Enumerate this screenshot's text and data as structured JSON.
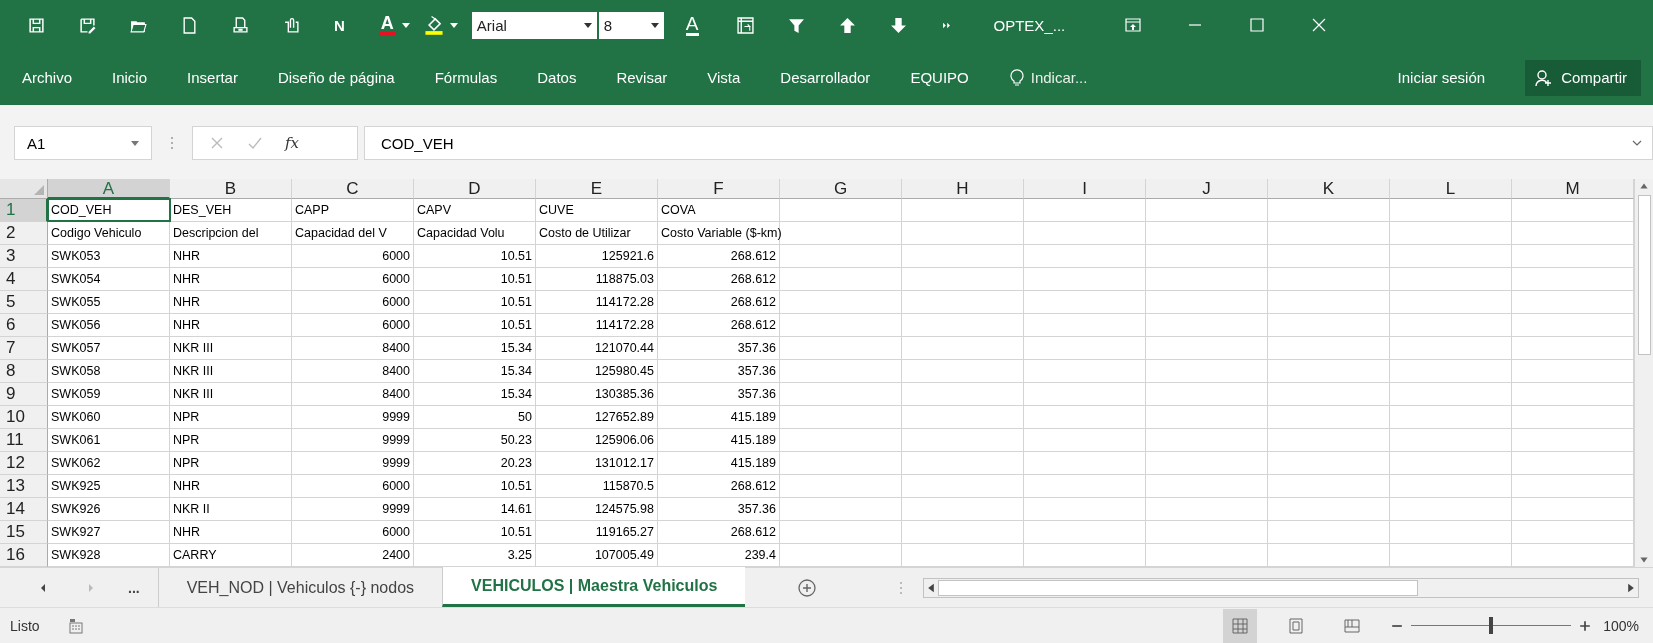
{
  "title_bar": {
    "toolbar": [
      {
        "kind": "save"
      },
      {
        "kind": "save-edit"
      },
      {
        "kind": "folder"
      },
      {
        "kind": "page"
      },
      {
        "kind": "print-preview"
      },
      {
        "kind": "attach"
      },
      {
        "kind": "letter",
        "label": "N"
      },
      {
        "kind": "font-color",
        "label": "A",
        "color": "#e81123"
      },
      {
        "kind": "highlight",
        "color": "#ffff00"
      },
      {
        "kind": "font",
        "value": "Arial"
      },
      {
        "kind": "size",
        "value": "8"
      },
      {
        "kind": "underline-letter",
        "label": "A"
      },
      {
        "kind": "pivot"
      },
      {
        "kind": "filter"
      },
      {
        "kind": "arrow-up"
      },
      {
        "kind": "arrow-down"
      },
      {
        "kind": "more"
      }
    ],
    "title": "OPTEX_..."
  },
  "ribbon_tabs": [
    "Archivo",
    "Inicio",
    "Insertar",
    "Diseño de página",
    "Fórmulas",
    "Datos",
    "Revisar",
    "Vista",
    "Desarrollador",
    "EQUIPO"
  ],
  "tell_me": "Indicar...",
  "sign_in": "Iniciar sesión",
  "share": "Compartir",
  "formula_bar": {
    "name_box": "A1",
    "fx": "fx",
    "formula": "COD_VEH"
  },
  "columns": [
    {
      "label": "A",
      "kind": "text",
      "selected": true
    },
    {
      "label": "B",
      "kind": "text",
      "selected": false
    },
    {
      "label": "C",
      "kind": "number",
      "selected": false
    },
    {
      "label": "D",
      "kind": "number",
      "selected": false
    },
    {
      "label": "E",
      "kind": "number",
      "selected": false
    },
    {
      "label": "F",
      "kind": "number",
      "selected": false
    },
    {
      "label": "G",
      "selected": false
    },
    {
      "label": "H",
      "selected": false
    },
    {
      "label": "I",
      "selected": false
    },
    {
      "label": "J",
      "selected": false
    },
    {
      "label": "K",
      "selected": false
    },
    {
      "label": "L",
      "selected": false
    },
    {
      "label": "M",
      "selected": false
    }
  ],
  "rows": [
    {
      "number": "1",
      "kind": "header",
      "selected": true,
      "cells": [
        "COD_VEH",
        "DES_VEH",
        "CAPP",
        "CAPV",
        "CUVE",
        "COVA"
      ]
    },
    {
      "number": "2",
      "kind": "header",
      "selected": false,
      "cells": [
        "Codigo Vehiculo",
        "Descripcion del",
        "Capacidad del V",
        "Capacidad Volu",
        "Costo de Utilizar",
        "Costo Variable ($-km)"
      ]
    },
    {
      "number": "3",
      "kind": "data",
      "selected": false,
      "cells": [
        "SWK053",
        "NHR",
        "6000",
        "10.51",
        "125921.6",
        "268.612"
      ]
    },
    {
      "number": "4",
      "kind": "data",
      "selected": false,
      "cells": [
        "SWK054",
        "NHR",
        "6000",
        "10.51",
        "118875.03",
        "268.612"
      ]
    },
    {
      "number": "5",
      "kind": "data",
      "selected": false,
      "cells": [
        "SWK055",
        "NHR",
        "6000",
        "10.51",
        "114172.28",
        "268.612"
      ]
    },
    {
      "number": "6",
      "kind": "data",
      "selected": false,
      "cells": [
        "SWK056",
        "NHR",
        "6000",
        "10.51",
        "114172.28",
        "268.612"
      ]
    },
    {
      "number": "7",
      "kind": "data",
      "selected": false,
      "cells": [
        "SWK057",
        "NKR III",
        "8400",
        "15.34",
        "121070.44",
        "357.36"
      ]
    },
    {
      "number": "8",
      "kind": "data",
      "selected": false,
      "cells": [
        "SWK058",
        "NKR III",
        "8400",
        "15.34",
        "125980.45",
        "357.36"
      ]
    },
    {
      "number": "9",
      "kind": "data",
      "selected": false,
      "cells": [
        "SWK059",
        "NKR III",
        "8400",
        "15.34",
        "130385.36",
        "357.36"
      ]
    },
    {
      "number": "10",
      "kind": "data",
      "selected": false,
      "cells": [
        "SWK060",
        "NPR",
        "9999",
        "50",
        "127652.89",
        "415.189"
      ]
    },
    {
      "number": "11",
      "kind": "data",
      "selected": false,
      "cells": [
        "SWK061",
        "NPR",
        "9999",
        "50.23",
        "125906.06",
        "415.189"
      ]
    },
    {
      "number": "12",
      "kind": "data",
      "selected": false,
      "cells": [
        "SWK062",
        "NPR",
        "9999",
        "20.23",
        "131012.17",
        "415.189"
      ]
    },
    {
      "number": "13",
      "kind": "data",
      "selected": false,
      "cells": [
        "SWK925",
        "NHR",
        "6000",
        "10.51",
        "115870.5",
        "268.612"
      ]
    },
    {
      "number": "14",
      "kind": "data",
      "selected": false,
      "cells": [
        "SWK926",
        "NKR II",
        "9999",
        "14.61",
        "124575.98",
        "357.36"
      ]
    },
    {
      "number": "15",
      "kind": "data",
      "selected": false,
      "cells": [
        "SWK927",
        "NHR",
        "6000",
        "10.51",
        "119165.27",
        "268.612"
      ]
    },
    {
      "number": "16",
      "kind": "data",
      "selected": false,
      "cells": [
        "SWK928",
        "CARRY",
        "2400",
        "3.25",
        "107005.49",
        "239.4"
      ]
    }
  ],
  "sheet_tabs": {
    "more": "...",
    "tabs": [
      {
        "label": "VEH_NOD | Vehiculos {-} nodos",
        "selected": false
      },
      {
        "label": "VEHICULOS | Maestra Vehiculos",
        "selected": true
      }
    ]
  },
  "status_bar": {
    "status": "Listo",
    "views": [
      {
        "kind": "normal",
        "selected": true
      },
      {
        "kind": "page-layout",
        "selected": false
      },
      {
        "kind": "page-break",
        "selected": false
      }
    ],
    "zoom": {
      "level": 0.5,
      "reading": "100%"
    }
  }
}
